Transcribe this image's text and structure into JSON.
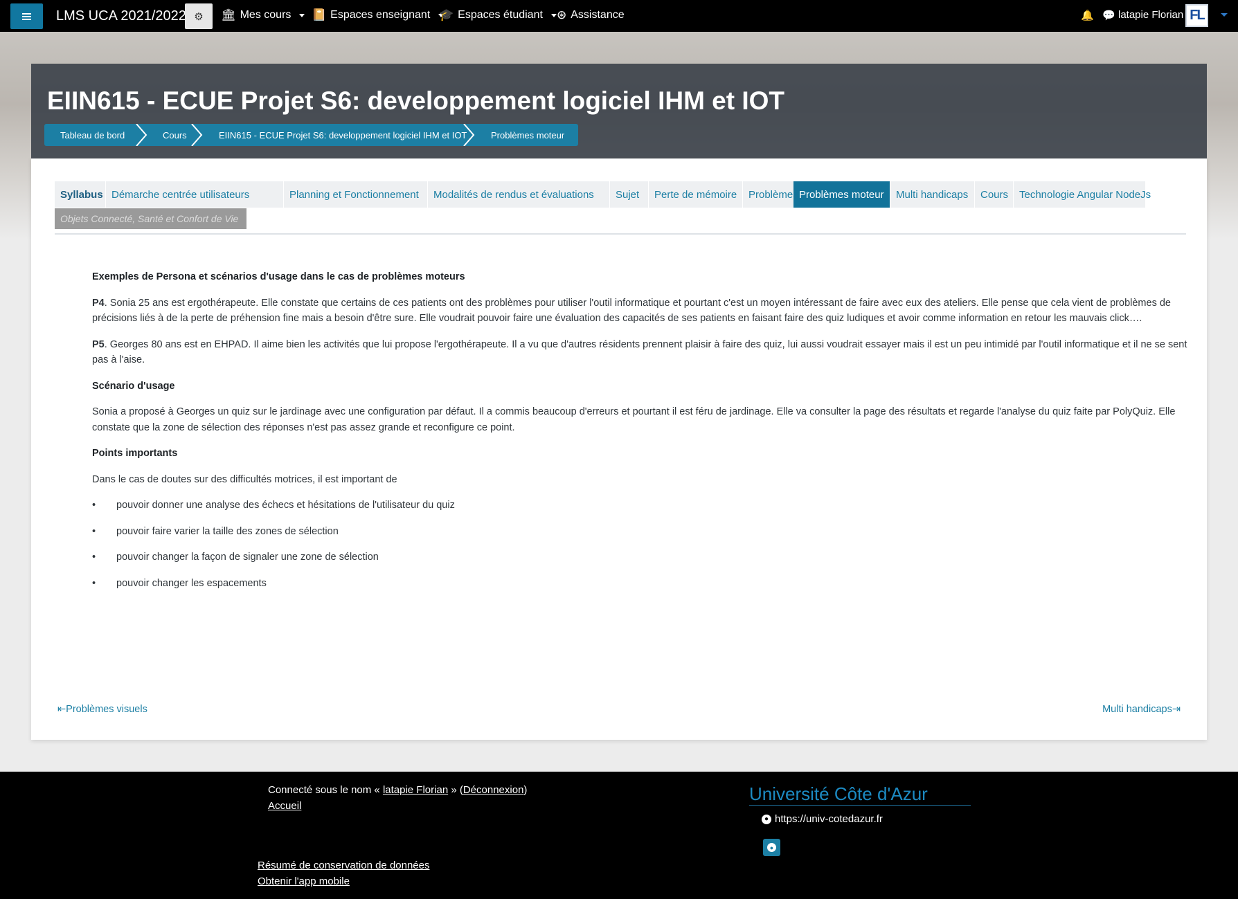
{
  "navbar": {
    "brand": "LMS UCA 2021/2022",
    "menus": [
      "Mes cours",
      "Espaces enseignant",
      "Espaces étudiant",
      "Assistance"
    ],
    "user_name": "latapie Florian",
    "avatar_initials": "FL"
  },
  "header": {
    "course_title": "EIIN615 - ECUE Projet S6: developpement logiciel IHM et IOT",
    "breadcrumbs": [
      "Tableau de bord",
      "Cours",
      "EIIN615 - ECUE Projet S6: developpement logiciel IHM et IOT",
      "Problèmes moteur"
    ]
  },
  "tabs": [
    {
      "label": "Syllabus",
      "state": "bold"
    },
    {
      "label": "Démarche centrée utilisateurs",
      "state": "normal"
    },
    {
      "label": "Planning et Fonctionnement",
      "state": "normal"
    },
    {
      "label": "Modalités de rendus et évaluations",
      "state": "normal"
    },
    {
      "label": "Sujet",
      "state": "normal"
    },
    {
      "label": "Perte de mémoire",
      "state": "normal"
    },
    {
      "label": "Problèmes visuels",
      "state": "normal"
    },
    {
      "label": "Problèmes moteur",
      "state": "active"
    },
    {
      "label": "Multi handicaps",
      "state": "normal"
    },
    {
      "label": "Cours",
      "state": "normal"
    },
    {
      "label": "Technologie Angular NodeJs",
      "state": "normal"
    },
    {
      "label": "Objets Connecté, Santé et Confort de Vie",
      "state": "disabled"
    }
  ],
  "content": {
    "heading1": "Exemples de Persona et scénarios d'usage dans le cas de problèmes moteurs",
    "p4_label": "P4",
    "p4_text": ". Sonia 25 ans est ergothérapeute. Elle constate que certains de ces patients ont des problèmes pour utiliser l'outil informatique et pourtant c'est un moyen intéressant de faire avec eux des ateliers. Elle pense que cela vient de problèmes de précisions liés à de la perte de préhension fine mais a besoin d'être sure. Elle voudrait pouvoir faire une évaluation des capacités de ses patients  en faisant  faire des quiz ludiques et avoir comme information en retour les mauvais click….",
    "p5_label": "P5",
    "p5_text": ". Georges 80 ans est en EHPAD. Il aime bien les activités que lui propose l'ergothérapeute. Il a vu que d'autres résidents prennent plaisir à faire des quiz, lui aussi voudrait essayer mais il est un peu intimidé par l'outil informatique et il ne se sent pas à l'aise.",
    "heading2": "Scénario d'usage",
    "scenario": "Sonia a proposé à Georges un quiz sur le jardinage avec une configuration par défaut.  Il a commis beaucoup d'erreurs et pourtant il est féru de jardinage. Elle va consulter la page des résultats et regarde l'analyse du quiz faite par PolyQuiz. Elle constate que la zone de sélection des réponses n'est pas assez grande et reconfigure ce point.",
    "heading3": "Points importants",
    "intro": "Dans le cas de doutes sur des difficultés motrices, il est important de",
    "points": [
      "pouvoir donner une analyse des échecs et hésitations de l'utilisateur du quiz",
      "pouvoir faire varier la taille des zones de sélection",
      "pouvoir changer la façon de signaler une zone de sélection",
      "pouvoir changer les espacements"
    ]
  },
  "pager": {
    "prev": "Problèmes visuels",
    "next": "Multi handicaps"
  },
  "footer": {
    "connected_prefix": "Connecté sous le nom « ",
    "connected_user": "latapie Florian",
    "connected_mid": " » (",
    "logout": "Déconnexion",
    "connected_suffix": ")",
    "home": "Accueil",
    "data_summary": "Résumé de conservation de données",
    "mobile_app": "Obtenir l'app mobile",
    "university": "Université Côte d'Azur",
    "url": "https://univ-cotedazur.fr"
  }
}
